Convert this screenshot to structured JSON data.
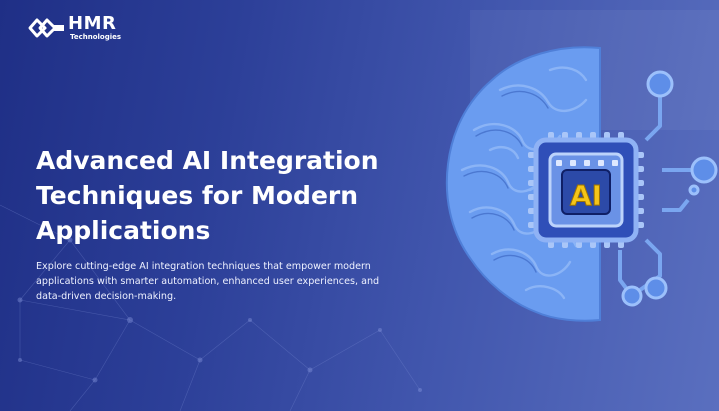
{
  "brand": {
    "name": "HMR",
    "tagline": "Technologies"
  },
  "hero": {
    "headline": "Advanced AI Integration Techniques for Modern Applications",
    "description": "Explore cutting-edge AI integration techniques that empower modern applications with smarter automation, enhanced user experiences, and data-driven decision-making."
  },
  "illustration": {
    "chip_label": "AI",
    "icons": [
      "brain-icon",
      "ai-chip-icon",
      "circuit-node-icon"
    ]
  },
  "colors": {
    "background_start": "#1f2f86",
    "background_end": "#5a6fbf",
    "brain": "#6a9cf0",
    "chip_label": "#f5c518"
  }
}
